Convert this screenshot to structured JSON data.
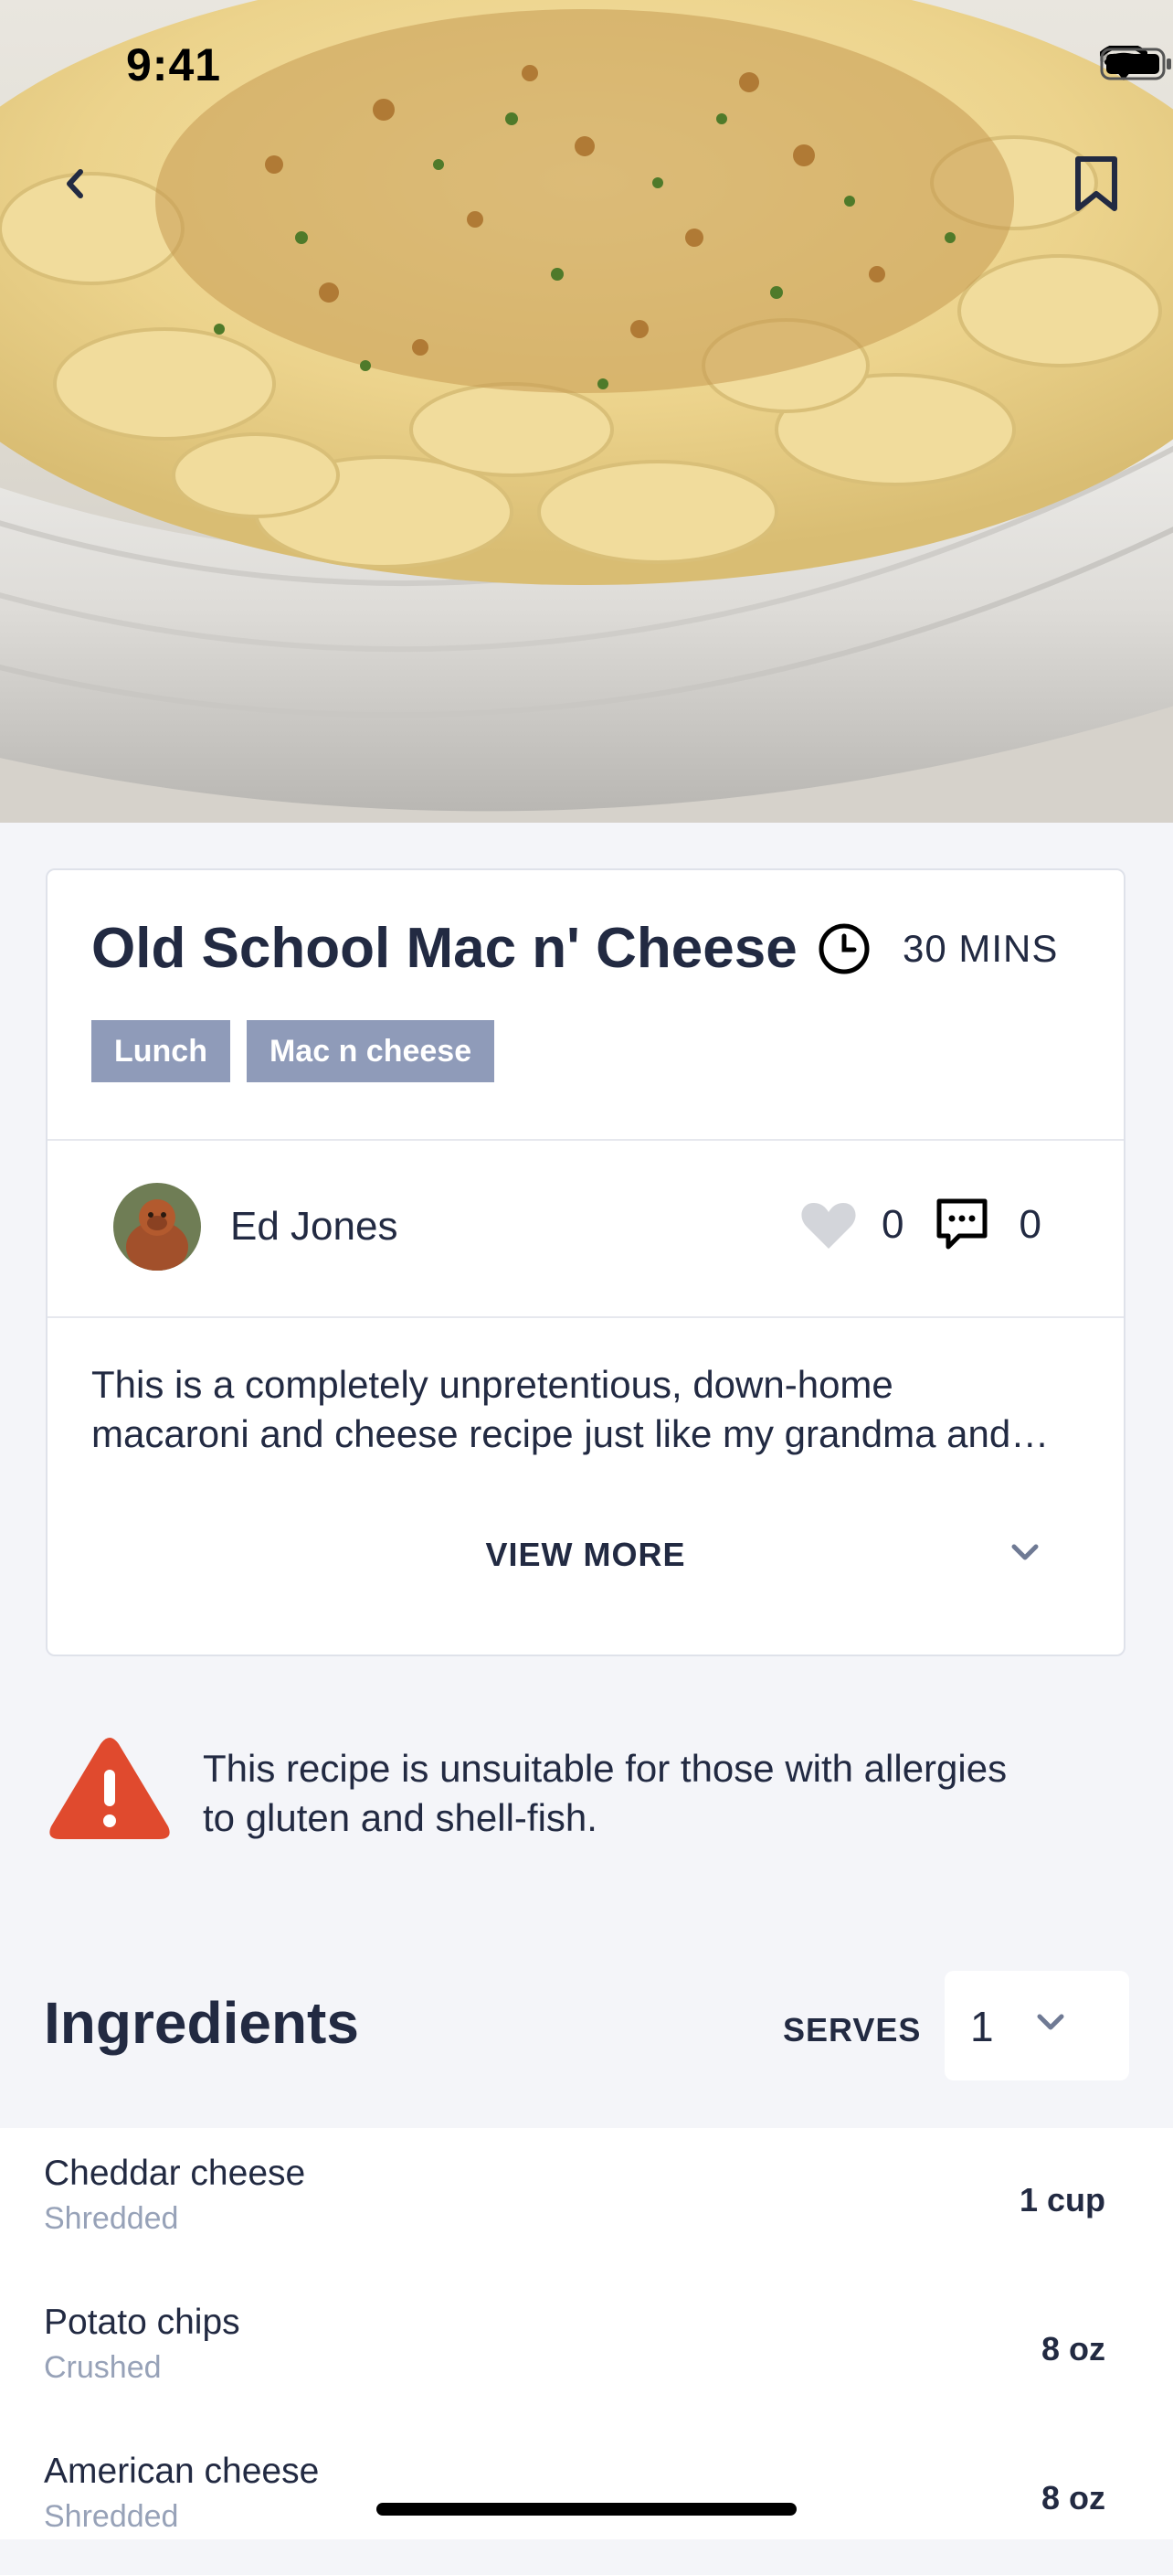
{
  "status_bar": {
    "time": "9:41"
  },
  "recipe": {
    "title": "Old School Mac n' Cheese",
    "duration": "30 MINS",
    "tags": [
      "Lunch",
      "Mac n cheese"
    ],
    "author": "Ed Jones",
    "likes": "0",
    "comments": "0",
    "description_lines": [
      "This is a completely unpretentious, down-home",
      "macaroni and cheese recipe just like my grandma and…"
    ],
    "view_more_label": "VIEW MORE"
  },
  "allergy": {
    "lines": [
      "This recipe is unsuitable for those with allergies",
      "to gluten and shell-fish."
    ]
  },
  "ingredients": {
    "title": "Ingredients",
    "serves_label": "SERVES",
    "serves_value": "1",
    "items": [
      {
        "name": "Cheddar cheese",
        "note": "Shredded",
        "qty": "1 cup"
      },
      {
        "name": "Potato chips",
        "note": "Crushed",
        "qty": "8 oz"
      },
      {
        "name": "American cheese",
        "note": "Shredded",
        "qty": "8 oz"
      }
    ]
  },
  "colors": {
    "text": "#222a42",
    "tag_bg": "#8f9bb9",
    "muted": "#97a2b8",
    "warning": "#e04a2e",
    "background": "#f4f5f9"
  },
  "icons": [
    "back-icon",
    "bookmark-icon",
    "clock-icon",
    "heart-icon",
    "comment-icon",
    "chevron-down-icon",
    "warning-icon"
  ]
}
